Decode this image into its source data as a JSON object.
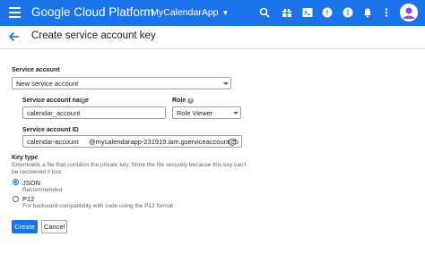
{
  "app": {
    "brand": "Google Cloud Platform",
    "project": "MyCalendarApp",
    "icons": [
      "menu-icon",
      "project-dots-icon",
      "search-icon",
      "gift-icon",
      "cloud-shell-icon",
      "help-icon",
      "more-vert-icon",
      "notifications-icon",
      "more-options-icon",
      "account-avatar"
    ]
  },
  "page": {
    "title": "Create service account key",
    "service_account_label": "Service account",
    "service_account_value": "New service account",
    "name_label": "Service account name",
    "name_value": "calendar_account",
    "role_label": "Role",
    "role_value": "Role Viewer",
    "id_label": "Service account ID",
    "id_value": "calendar-account",
    "id_suffix": "@mycalendarapp-231919.iam.gserviceaccount.co",
    "key_type_label": "Key type",
    "key_type_desc_line1": "Downloads a file that contains the private key. Store the file securely because this key can't",
    "key_type_desc_line2": "be recovered if lost.",
    "json_label": "JSON",
    "json_desc": "Recommended",
    "p12_label": "P12",
    "p12_desc": "For backward compatibility with code using the P12 format",
    "create_button": "Create",
    "cancel_button": "Cancel"
  },
  "colors": {
    "topbar": "#1a73e8",
    "accent": "#1a73e8"
  }
}
